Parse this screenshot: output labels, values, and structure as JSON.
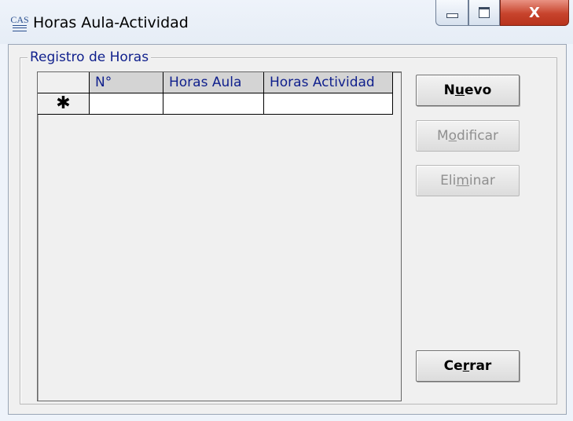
{
  "window": {
    "title": "Horas Aula-Actividad",
    "app_icon_text": "CAS",
    "close_glyph": "X"
  },
  "group": {
    "legend": "Registro de Horas"
  },
  "grid": {
    "columns": [
      "N°",
      "Horas Aula",
      "Horas Actividad"
    ],
    "new_row_marker": "✱",
    "rows": []
  },
  "buttons": {
    "nuevo": {
      "pre": "N",
      "mnemonic": "u",
      "post": "evo",
      "enabled": true
    },
    "modificar": {
      "pre": "M",
      "mnemonic": "o",
      "post": "dificar",
      "enabled": false
    },
    "eliminar": {
      "pre": "Eli",
      "mnemonic": "m",
      "post": "inar",
      "enabled": false
    },
    "cerrar": {
      "pre": "Ce",
      "mnemonic": "r",
      "post": "rar",
      "enabled": true
    }
  },
  "colors": {
    "label_blue": "#0f1f8c",
    "close_red": "#c7432c",
    "disabled_text": "#8f8f8f"
  }
}
